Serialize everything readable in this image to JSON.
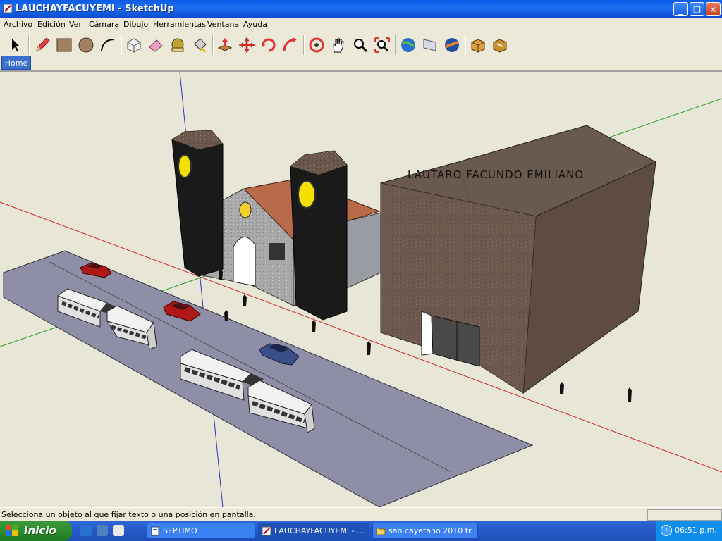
{
  "window": {
    "title": "LAUCHAYFACUYEMI - SketchUp",
    "minimize_label": "_",
    "maximize_label": "❐",
    "close_label": "✕"
  },
  "menu": {
    "items": [
      "Archivo",
      "Edición",
      "Ver",
      "Cámara",
      "Dibujo",
      "Herramientas",
      "Ventana",
      "Ayuda"
    ]
  },
  "toolbar": {
    "tools": [
      "select-icon",
      "pencil-icon",
      "rectangle-icon",
      "circle-icon",
      "arc-icon",
      "make-component-icon",
      "eraser-icon",
      "tape-measure-icon",
      "paint-bucket-icon",
      "push-pull-icon",
      "move-icon",
      "rotate-icon",
      "follow-me-icon",
      "orbit-icon",
      "pan-icon",
      "zoom-icon",
      "zoom-extents-icon",
      "get-models-icon",
      "share-model-icon",
      "google-earth-icon",
      "get-component-icon",
      "share-component-icon"
    ]
  },
  "scene_tabs": {
    "home_label": "Home"
  },
  "model": {
    "text_label": "LAUTARO FACUNDO EMILIANO"
  },
  "status": {
    "message": "Selecciona un objeto al que fijar texto o una posición en pantalla."
  },
  "taskbar": {
    "start_label": "Inicio",
    "tasks": [
      {
        "label": "SEPTIMO",
        "active": false
      },
      {
        "label": "LAUCHAYFACUYEMI - ...",
        "active": true
      },
      {
        "label": "san cayetano 2010 tr...",
        "active": false
      }
    ],
    "clock": "06:51 p.m."
  },
  "colors": {
    "title_bar": "#0a5ce6",
    "axis_red": "#d02020",
    "axis_green": "#20a020",
    "axis_blue": "#2020c0",
    "road": "#8e8ea6",
    "tower": "#1a1a1a",
    "clock_face": "#f5e000",
    "roof": "#b86a4a",
    "hall_wall": "#6e5a4e"
  }
}
